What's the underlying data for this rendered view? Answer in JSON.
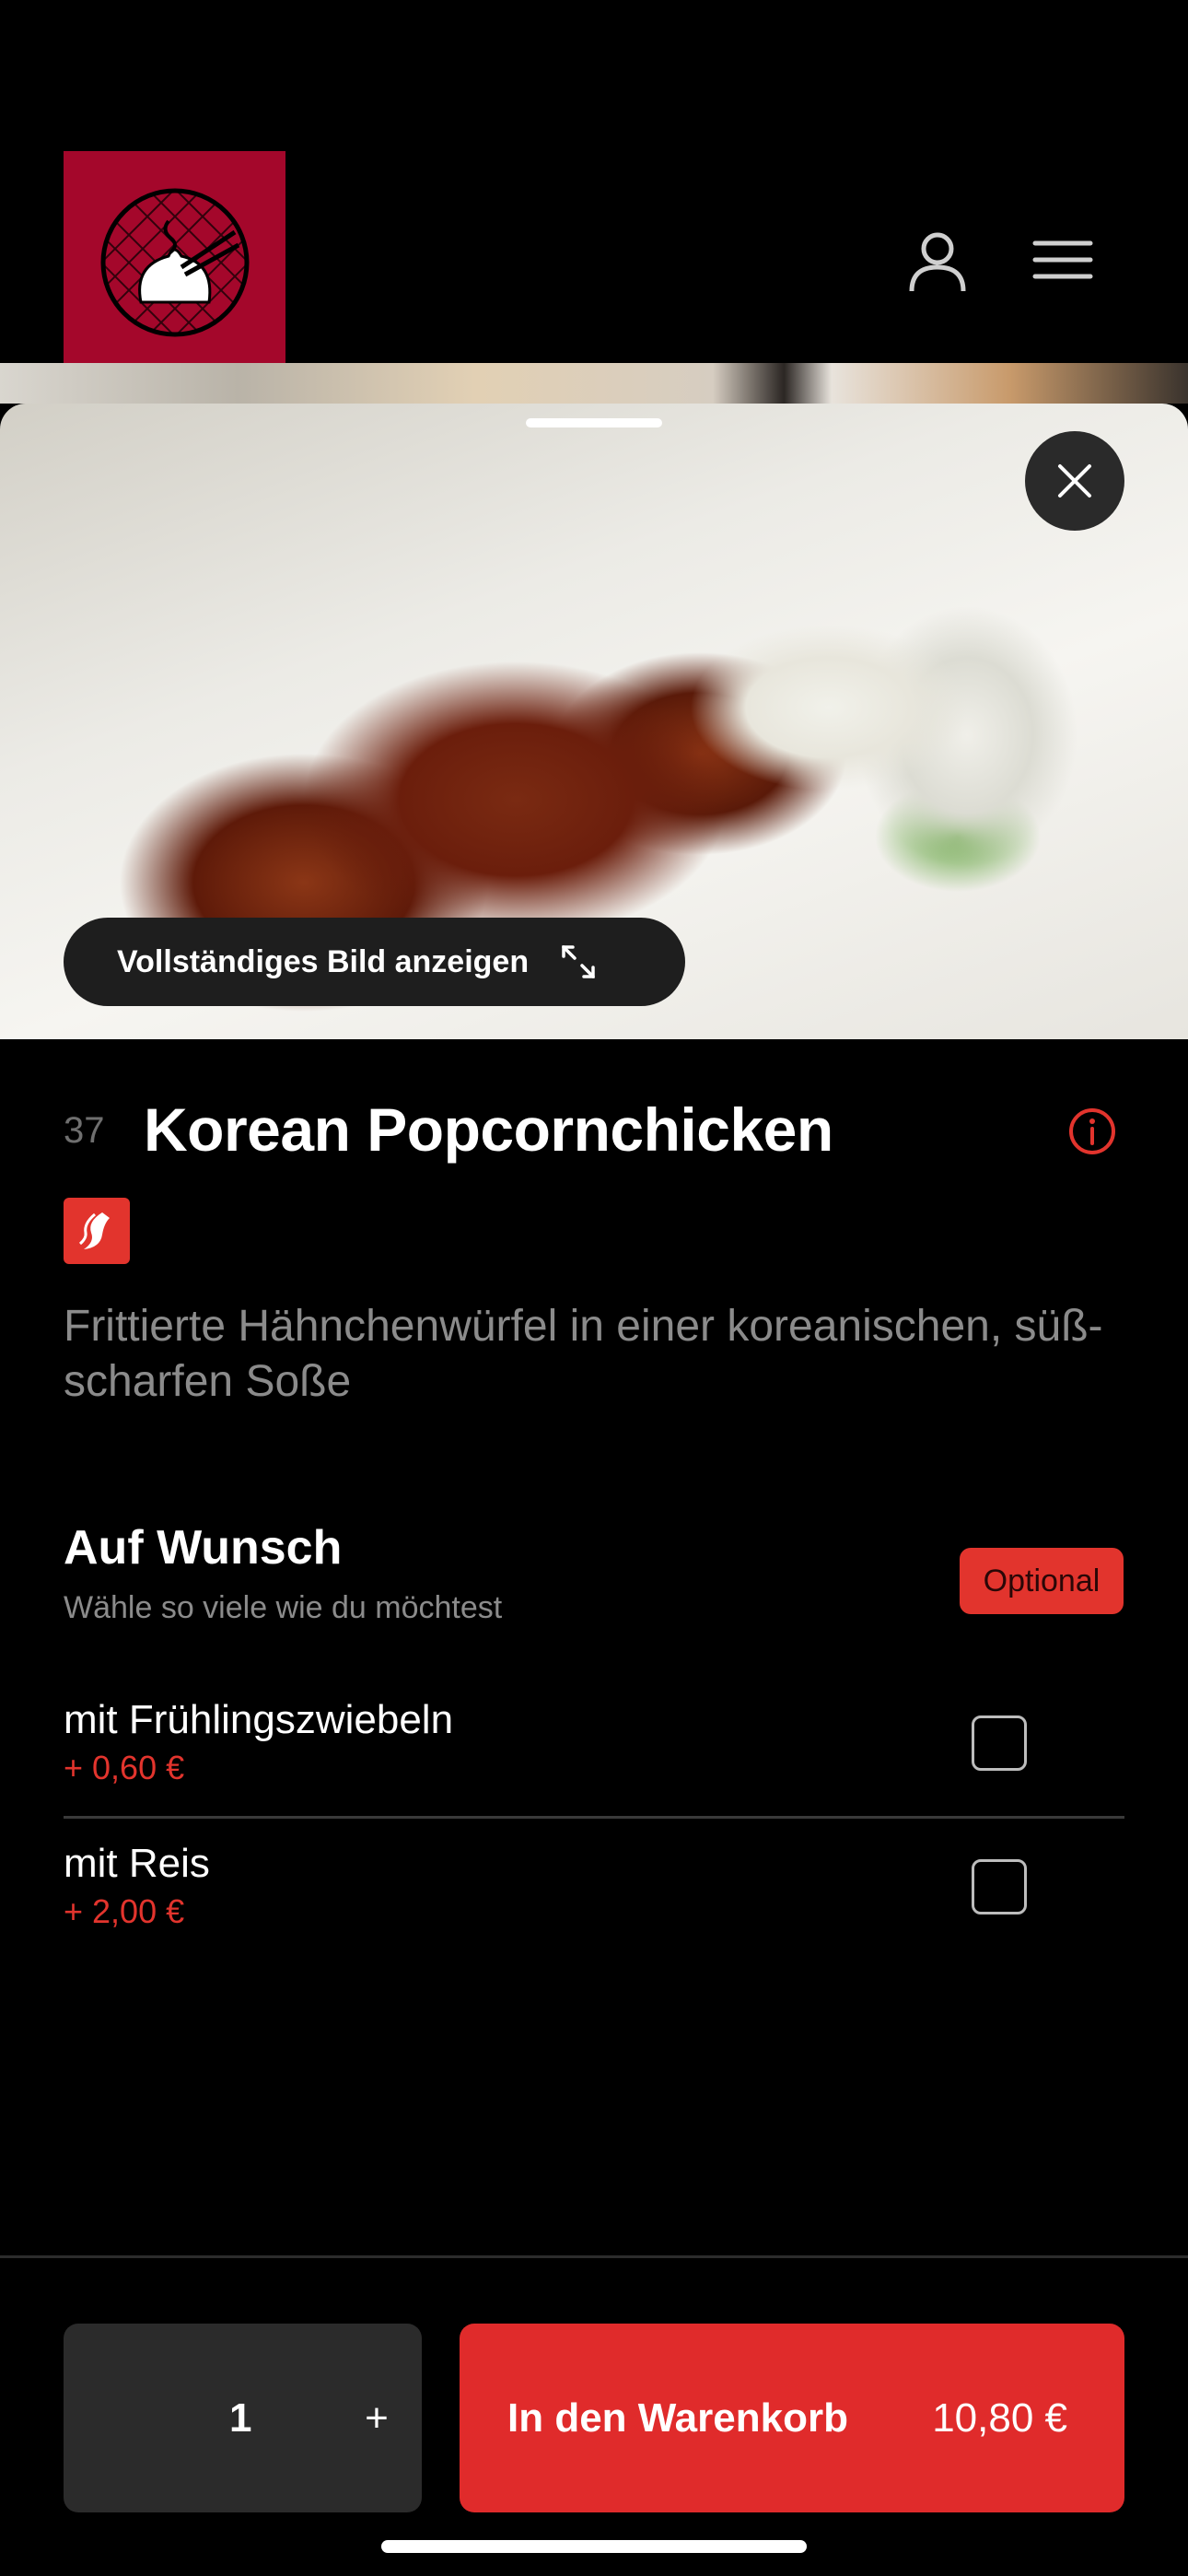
{
  "header": {
    "logo_icon": "dumpling-chopsticks-logo",
    "account_icon": "user-icon",
    "menu_icon": "hamburger-menu-icon"
  },
  "product": {
    "image_button_label": "Vollständiges Bild anzeigen",
    "number": "37",
    "title": "Korean Popcornchicken",
    "spicy_icon": "chili-icon",
    "description": "Frittierte Hähnchenwürfel in einer koreanischen, süß-scharfen Soße"
  },
  "options_section": {
    "title": "Auf Wunsch",
    "subtitle": "Wähle so viele wie du möchtest",
    "badge": "Optional",
    "items": [
      {
        "name": "mit Frühlingszwiebeln",
        "price": "+ 0,60 €",
        "checked": false
      },
      {
        "name": "mit Reis",
        "price": "+ 2,00 €",
        "checked": false
      }
    ]
  },
  "cart_bar": {
    "quantity": "1",
    "plus": "+",
    "add_label": "In den Warenkorb",
    "total": "10,80 €"
  },
  "colors": {
    "accent": "#e2342d",
    "logo_bg": "#a4072b",
    "background": "#000000"
  }
}
